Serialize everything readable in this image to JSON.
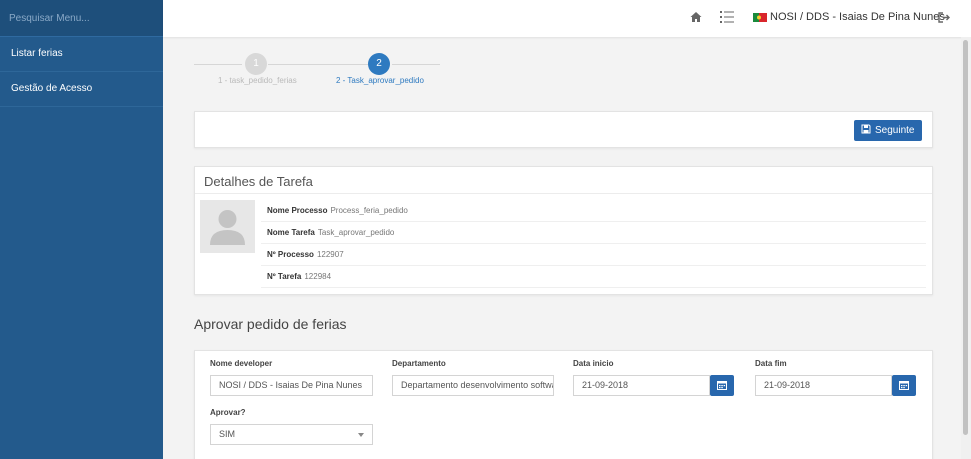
{
  "sidebar": {
    "search_placeholder": "Pesquisar Menu...",
    "items": [
      {
        "label": "Listar ferias"
      },
      {
        "label": "Gestão de Acesso"
      }
    ]
  },
  "header": {
    "user_label": "NOSI / DDS - Isaias De Pina Nunes",
    "icons": [
      "home-icon",
      "list-icon",
      "flag-icon",
      "logout-icon"
    ]
  },
  "wizard": {
    "steps": [
      {
        "number": "1",
        "label": "1 - task_pedido_ferias",
        "state": "done"
      },
      {
        "number": "2",
        "label": "2 - Task_aprovar_pedido",
        "state": "active"
      }
    ]
  },
  "toolbar": {
    "next_label": "Seguinte"
  },
  "task_details": {
    "title": "Detalhes de Tarefa",
    "rows": [
      {
        "label": "Nome Processo",
        "value": "Process_feria_pedido"
      },
      {
        "label": "Nome Tarefa",
        "value": "Task_aprovar_pedido"
      },
      {
        "label": "Nº Processo",
        "value": "122907"
      },
      {
        "label": "Nº Tarefa",
        "value": "122984"
      }
    ]
  },
  "form": {
    "title": "Aprovar pedido de ferias",
    "fields": {
      "developer": {
        "label": "Nome developer",
        "value": "NOSI / DDS - Isaias De Pina Nunes"
      },
      "department": {
        "label": "Departamento",
        "value": "Departamento desenvolvimento software"
      },
      "start_date": {
        "label": "Data inicio",
        "value": "21-09-2018"
      },
      "end_date": {
        "label": "Data fim",
        "value": "21-09-2018"
      },
      "approve": {
        "label": "Aprovar?",
        "value": "SIM"
      }
    }
  },
  "colors": {
    "sidebar": "#235a8c",
    "primary": "#2867ad",
    "wizard_active": "#2e7ac0"
  }
}
